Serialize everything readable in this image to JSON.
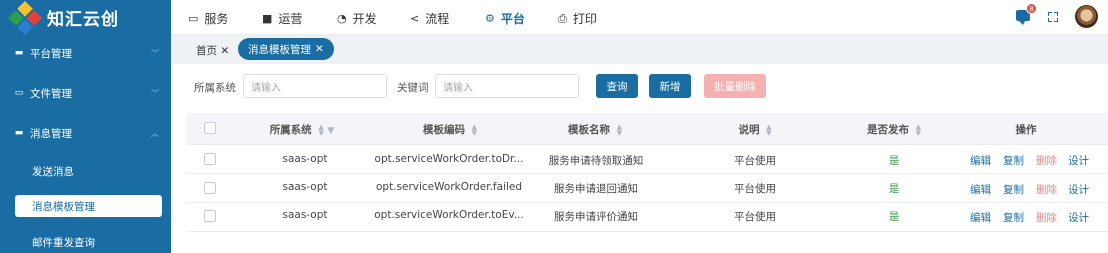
{
  "brand": {
    "name": "知汇云创"
  },
  "sidebar": {
    "items": [
      {
        "label": "平台管理",
        "icon": "monitor-icon"
      },
      {
        "label": "文件管理",
        "icon": "folder-icon"
      },
      {
        "label": "消息管理",
        "icon": "message-icon"
      }
    ],
    "sub_items": [
      {
        "label": "发送消息"
      },
      {
        "label": "消息模板管理"
      },
      {
        "label": "邮件重发查询"
      }
    ]
  },
  "topnav": {
    "items": [
      {
        "label": "服务",
        "icon": "service-icon"
      },
      {
        "label": "运营",
        "icon": "operations-icon"
      },
      {
        "label": "开发",
        "icon": "develop-icon"
      },
      {
        "label": "流程",
        "icon": "flow-icon"
      },
      {
        "label": "平台",
        "icon": "platform-icon"
      },
      {
        "label": "打印",
        "icon": "print-icon"
      }
    ],
    "active": "平台",
    "notification_count": "8"
  },
  "tabs": [
    {
      "label": "首页"
    },
    {
      "label": "消息模板管理"
    }
  ],
  "filters": {
    "system_label": "所属系统",
    "system_placeholder": "请输入",
    "keyword_label": "关键词",
    "keyword_placeholder": "请输入"
  },
  "buttons": {
    "query": "查询",
    "add": "新增",
    "batch_delete": "批量删除"
  },
  "table": {
    "columns": [
      "所属系统",
      "模板编码",
      "模板名称",
      "说明",
      "是否发布",
      "操作"
    ],
    "rows": [
      {
        "system": "saas-opt",
        "code": "opt.serviceWorkOrder.toDr...",
        "name": "服务申请待领取通知",
        "desc": "平台使用",
        "published": "是"
      },
      {
        "system": "saas-opt",
        "code": "opt.serviceWorkOrder.failed",
        "name": "服务申请退回通知",
        "desc": "平台使用",
        "published": "是"
      },
      {
        "system": "saas-opt",
        "code": "opt.serviceWorkOrder.toEv...",
        "name": "服务申请评价通知",
        "desc": "平台使用",
        "published": "是"
      }
    ],
    "actions": [
      "编辑",
      "复制",
      "删除",
      "设计"
    ]
  },
  "colors": {
    "primary": "#1a6da3",
    "danger_light": "#f5b0b0",
    "success": "#3fa14a"
  }
}
